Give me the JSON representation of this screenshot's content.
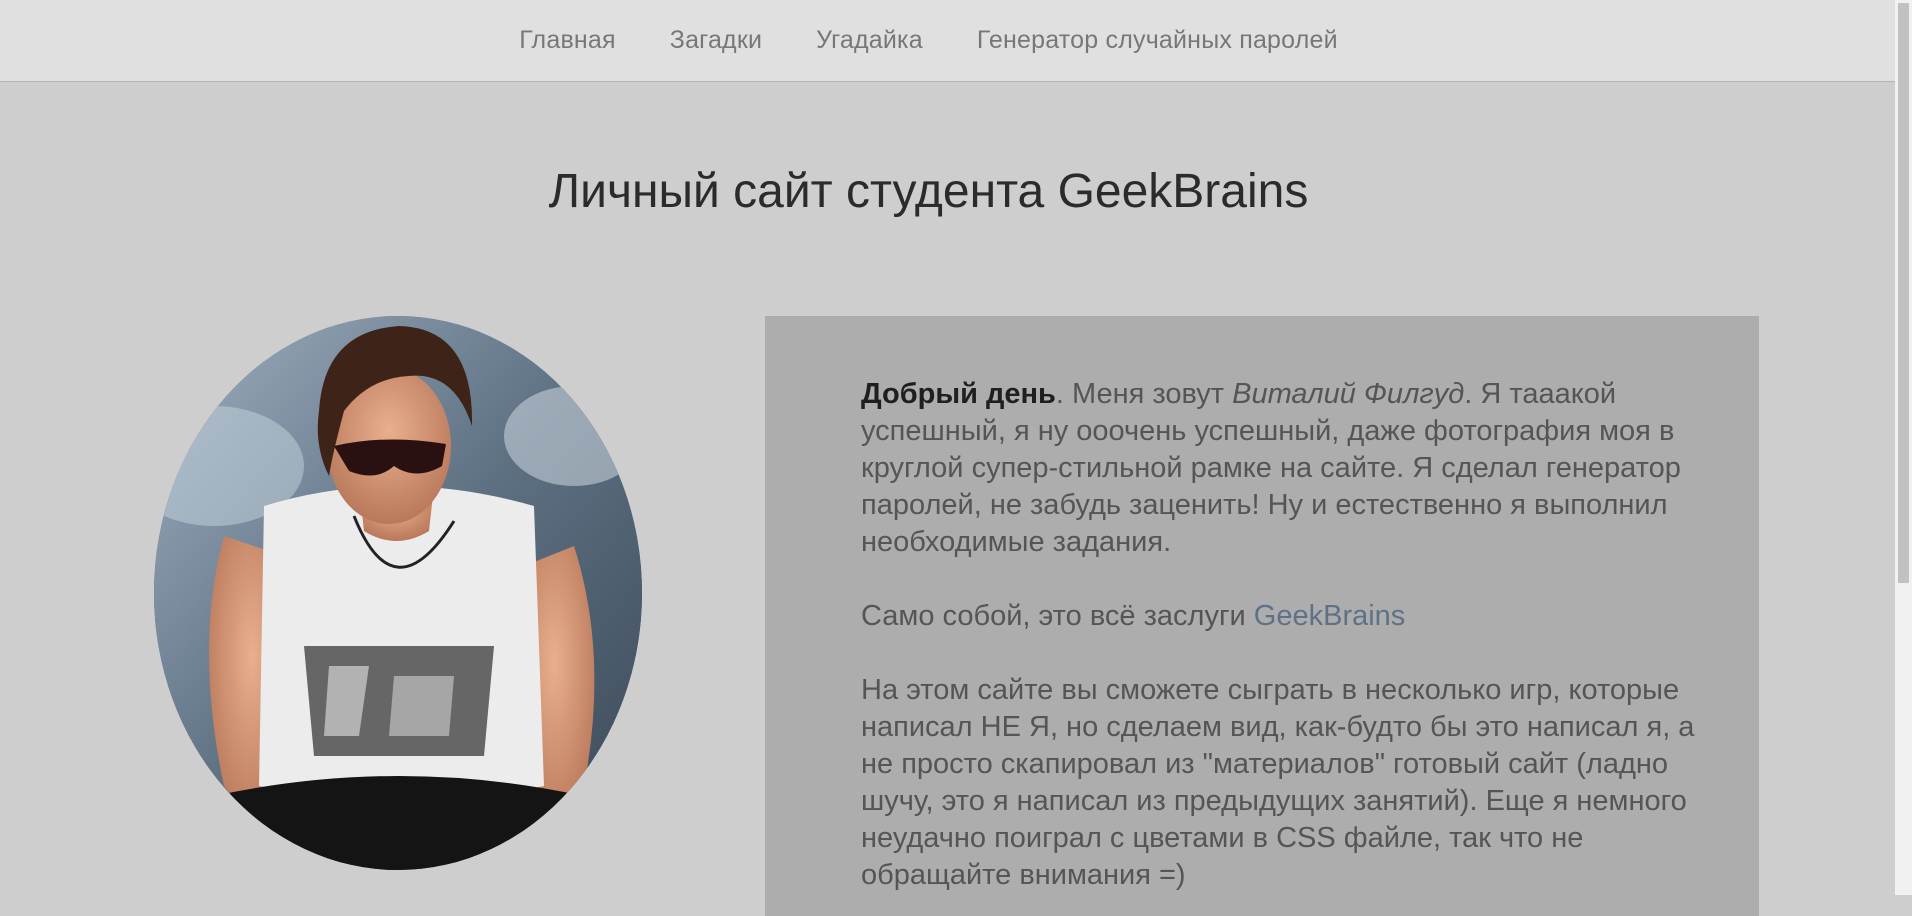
{
  "nav": {
    "items": [
      {
        "label": "Главная"
      },
      {
        "label": "Загадки"
      },
      {
        "label": "Угадайка"
      },
      {
        "label": "Генератор случайных паролей"
      }
    ]
  },
  "header": {
    "title": "Личный сайт студента GeekBrains"
  },
  "intro": {
    "greeting": "Добрый день",
    "text_before_name": ". Меня зовут ",
    "name": "Виталий Филгуд",
    "text_after_name": ". Я тааакой успешный, я ну ооочень успешный, даже фотография моя в круглой супер-стильной рамке на сайте. Я сделал генератор паролей, не забудь заценить! Ну и естественно я выполнил необходимые задания."
  },
  "credits": {
    "text": "Само собой, это всё заслуги ",
    "link_label": "GeekBrains"
  },
  "games": {
    "text": "На этом сайте вы сможете сыграть в несколько игр, которые написал НЕ Я, но сделаем вид, как-будто бы это написал я, а не просто скапировал из \"материалов\" готовый сайт (ладно шучу, это я написал из предыдущих занятий). Еще я немного неудачно поиграл с цветами в CSS файле, так что не обращайте внимания =)"
  },
  "colors": {
    "page_bg": "#cecece",
    "nav_bg": "#e0e0e0",
    "content_bg": "#adadad",
    "link": "#5f7186"
  }
}
